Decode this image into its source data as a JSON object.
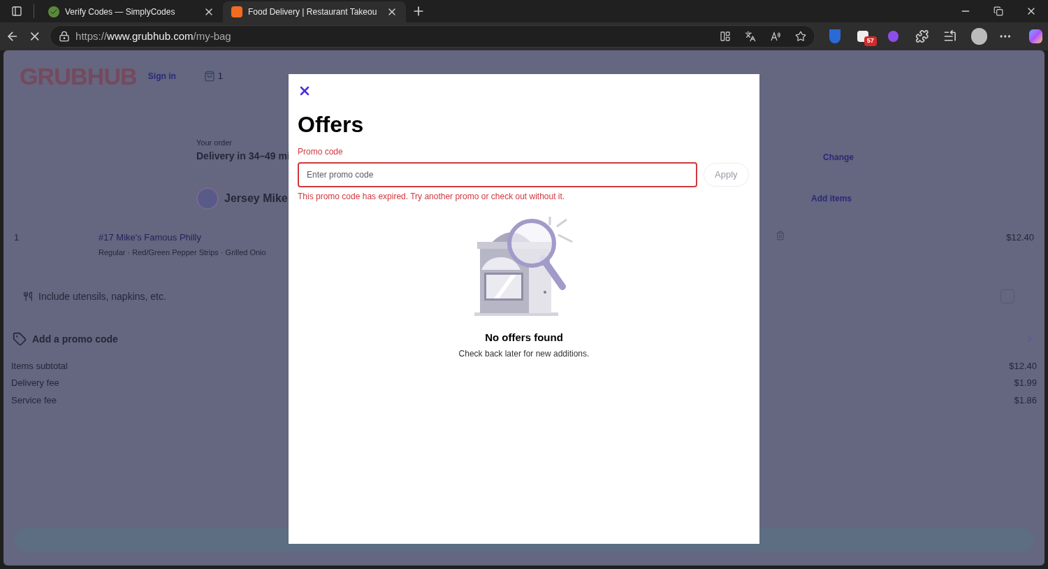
{
  "browser": {
    "tabs": [
      {
        "title": "Verify Codes — SimplyCodes",
        "selected": false
      },
      {
        "title": "Food Delivery | Restaurant Takeou",
        "selected": true
      }
    ],
    "address": {
      "scheme": "https://",
      "host": "www.grubhub.com",
      "path": "/my-bag"
    },
    "extension_badge": "57"
  },
  "header": {
    "logo": "GRUBHUB",
    "sign_in": "Sign in",
    "bag_count": "1"
  },
  "order": {
    "label": "Your order",
    "delivery": "Delivery in 34–49 mi",
    "change": "Change",
    "restaurant": "Jersey Mike",
    "add_items": "Add items"
  },
  "items": [
    {
      "quantity": "1",
      "name": "#17 Mike's Famous Philly",
      "options": "Regular · Red/Green Pepper Strips · Grilled Onio",
      "price": "$12.40"
    }
  ],
  "utensils": {
    "label": "Include utensils, napkins, etc.",
    "checked": false
  },
  "promo_link": "Add a promo code",
  "fees": [
    {
      "label": "Items subtotal",
      "amount": "$12.40"
    },
    {
      "label": "Delivery fee",
      "amount": "$1.99"
    },
    {
      "label": "Service fee",
      "amount": "$1.86"
    }
  ],
  "modal": {
    "title": "Offers",
    "field_label": "Promo code",
    "placeholder": "Enter promo code",
    "apply": "Apply",
    "error": "This promo code has expired. Try another promo or check out without it.",
    "empty_title": "No offers found",
    "empty_text": "Check back later for new additions."
  }
}
